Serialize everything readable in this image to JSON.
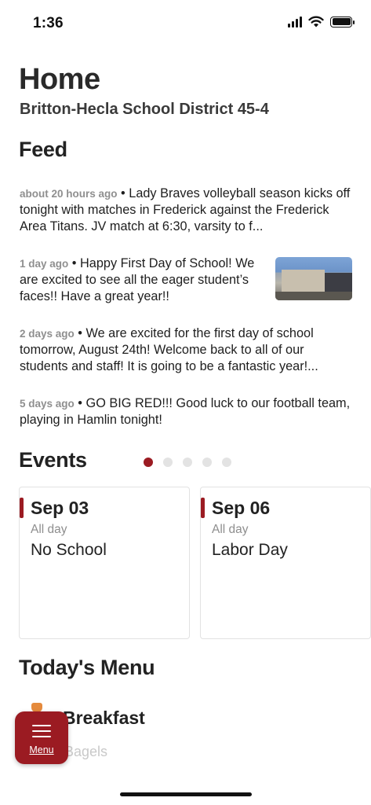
{
  "status_bar": {
    "time": "1:36"
  },
  "header": {
    "title": "Home",
    "district": "Britton-Hecla School District 45-4"
  },
  "feed": {
    "title": "Feed",
    "items": [
      {
        "time": "about 20 hours ago",
        "text": " • Lady Braves volleyball season kicks off tonight with matches in Frederick against the Frederick Area Titans. JV match at 6:30, varsity to f..."
      },
      {
        "time": "1 day ago",
        "text": " • Happy First Day of School! We are excited to see all the eager student’s faces!! Have a great year!!"
      },
      {
        "time": "2 days ago",
        "text": " • We are excited for the first day of school tomorrow, August 24th! Welcome back to all of our students and staff! It is going to be a fantastic year!..."
      },
      {
        "time": "5 days ago",
        "text": " • GO BIG RED!!! Good luck to our football team, playing in Hamlin tonight!"
      }
    ]
  },
  "events": {
    "title": "Events",
    "page_count": 5,
    "active_page": 1,
    "cards": [
      {
        "date": "Sep 03",
        "when": "All day",
        "name": "No School"
      },
      {
        "date": "Sep 06",
        "when": "All day",
        "name": "Labor Day"
      }
    ]
  },
  "menu": {
    "title": "Today's Menu",
    "meal": "Breakfast",
    "first_item": "Bagels"
  },
  "menu_button": {
    "label": "Menu"
  },
  "colors": {
    "accent": "#9b1b22"
  }
}
